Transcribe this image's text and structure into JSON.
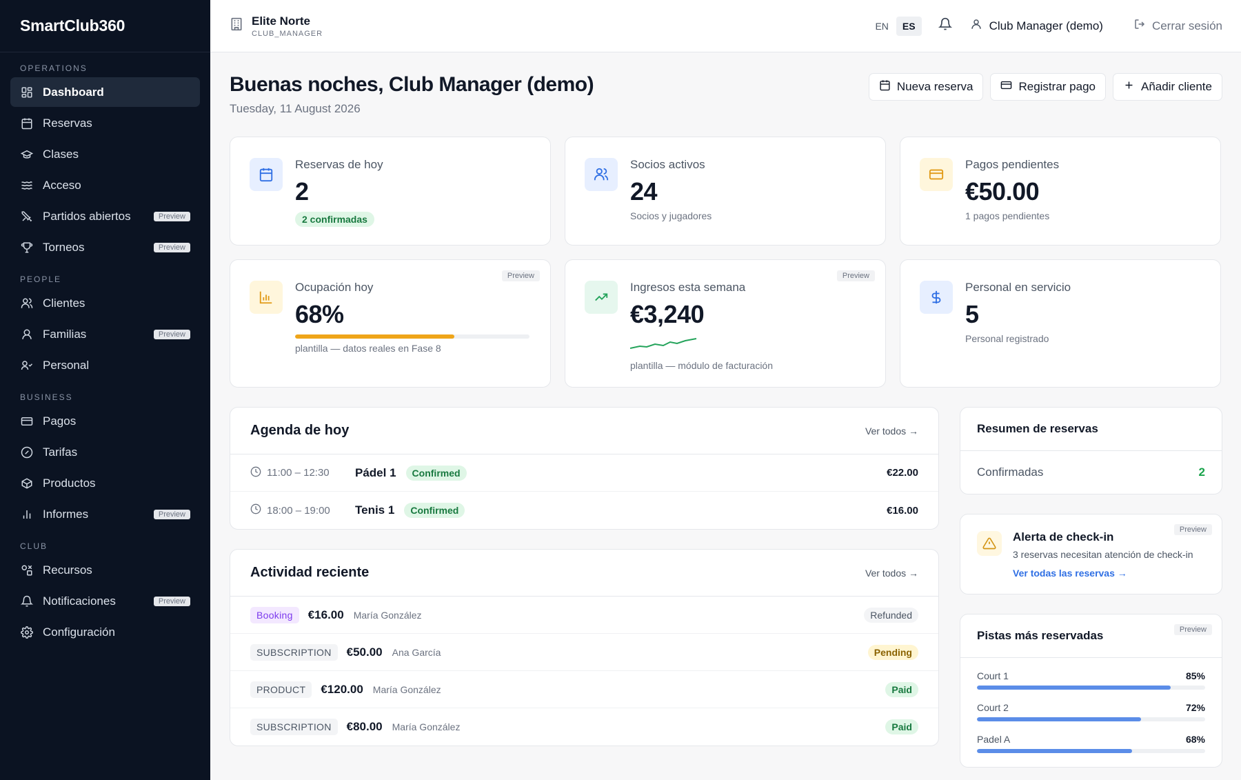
{
  "brand": "SmartClub360",
  "sidebar": {
    "sections": [
      {
        "label": "OPERATIONS",
        "items": [
          {
            "label": "Dashboard",
            "icon": "dashboard-icon",
            "active": true,
            "preview": false
          },
          {
            "label": "Reservas",
            "icon": "calendar-icon",
            "preview": false
          },
          {
            "label": "Clases",
            "icon": "graduation-cap-icon",
            "preview": false
          },
          {
            "label": "Acceso",
            "icon": "waves-icon",
            "preview": false
          },
          {
            "label": "Partidos abiertos",
            "icon": "swords-icon",
            "preview": true
          },
          {
            "label": "Torneos",
            "icon": "trophy-icon",
            "preview": true
          }
        ]
      },
      {
        "label": "PEOPLE",
        "items": [
          {
            "label": "Clientes",
            "icon": "users-icon",
            "preview": false
          },
          {
            "label": "Familias",
            "icon": "family-icon",
            "preview": true
          },
          {
            "label": "Personal",
            "icon": "staff-icon",
            "preview": false
          }
        ]
      },
      {
        "label": "BUSINESS",
        "items": [
          {
            "label": "Pagos",
            "icon": "credit-card-icon",
            "preview": false
          },
          {
            "label": "Tarifas",
            "icon": "percent-badge-icon",
            "preview": false
          },
          {
            "label": "Productos",
            "icon": "package-icon",
            "preview": false
          },
          {
            "label": "Informes",
            "icon": "bar-chart-icon",
            "preview": true
          }
        ]
      },
      {
        "label": "CLUB",
        "items": [
          {
            "label": "Recursos",
            "icon": "shapes-icon",
            "preview": false
          },
          {
            "label": "Notificaciones",
            "icon": "bell-icon",
            "preview": true
          },
          {
            "label": "Configuración",
            "icon": "gear-icon",
            "preview": false
          }
        ]
      }
    ],
    "preview_label": "Preview"
  },
  "topbar": {
    "club_name": "Elite Norte",
    "club_role": "CLUB_MANAGER",
    "lang_en": "EN",
    "lang_es": "ES",
    "user": "Club Manager (demo)",
    "logout": "Cerrar sesión"
  },
  "header": {
    "greeting": "Buenas noches, Club Manager (demo)",
    "date": "Tuesday, 11 August 2026",
    "actions": {
      "new_booking": "Nueva reserva",
      "register_payment": "Registrar pago",
      "add_client": "Añadir cliente"
    }
  },
  "stats": {
    "bookings_today": {
      "label": "Reservas de hoy",
      "value": "2",
      "sub": "2 confirmadas"
    },
    "active_members": {
      "label": "Socios activos",
      "value": "24",
      "sub": "Socios y jugadores"
    },
    "pending_payments": {
      "label": "Pagos pendientes",
      "value": "€50.00",
      "sub": "1 pagos pendientes"
    },
    "occupancy": {
      "label": "Ocupación hoy",
      "value": "68%",
      "progress": 0.68,
      "sub": "plantilla — datos reales en Fase 8",
      "preview": "Preview"
    },
    "weekly_revenue": {
      "label": "Ingresos esta semana",
      "value": "€3,240",
      "sub": "plantilla — módulo de facturación",
      "preview": "Preview"
    },
    "staff": {
      "label": "Personal en servicio",
      "value": "5",
      "sub": "Personal registrado"
    }
  },
  "agenda": {
    "title": "Agenda de hoy",
    "see_all": "Ver todos →",
    "rows": [
      {
        "time": "11:00 – 12:30",
        "court": "Pádel 1",
        "status": "Confirmed",
        "amount": "€22.00"
      },
      {
        "time": "18:00 – 19:00",
        "court": "Tenis 1",
        "status": "Confirmed",
        "amount": "€16.00"
      }
    ]
  },
  "activity": {
    "title": "Actividad reciente",
    "see_all": "Ver todos →",
    "rows": [
      {
        "type": "Booking",
        "amount": "€16.00",
        "name": "María González",
        "status": "Refunded"
      },
      {
        "type": "SUBSCRIPTION",
        "amount": "€50.00",
        "name": "Ana García",
        "status": "Pending"
      },
      {
        "type": "PRODUCT",
        "amount": "€120.00",
        "name": "María González",
        "status": "Paid"
      },
      {
        "type": "SUBSCRIPTION",
        "amount": "€80.00",
        "name": "María González",
        "status": "Paid"
      }
    ]
  },
  "summary": {
    "title": "Resumen de reservas",
    "label": "Confirmadas",
    "value": "2"
  },
  "checkin_alert": {
    "title": "Alerta de check-in",
    "text": "3 reservas necesitan atención de check-in",
    "link": "Ver todas las reservas →",
    "preview": "Preview"
  },
  "top_courts": {
    "title": "Pistas más reservadas",
    "preview": "Preview",
    "courts": [
      {
        "name": "Court 1",
        "pct": "85%",
        "value": 0.85
      },
      {
        "name": "Court 2",
        "pct": "72%",
        "value": 0.72
      },
      {
        "name": "Padel A",
        "pct": "68%",
        "value": 0.68
      }
    ]
  }
}
